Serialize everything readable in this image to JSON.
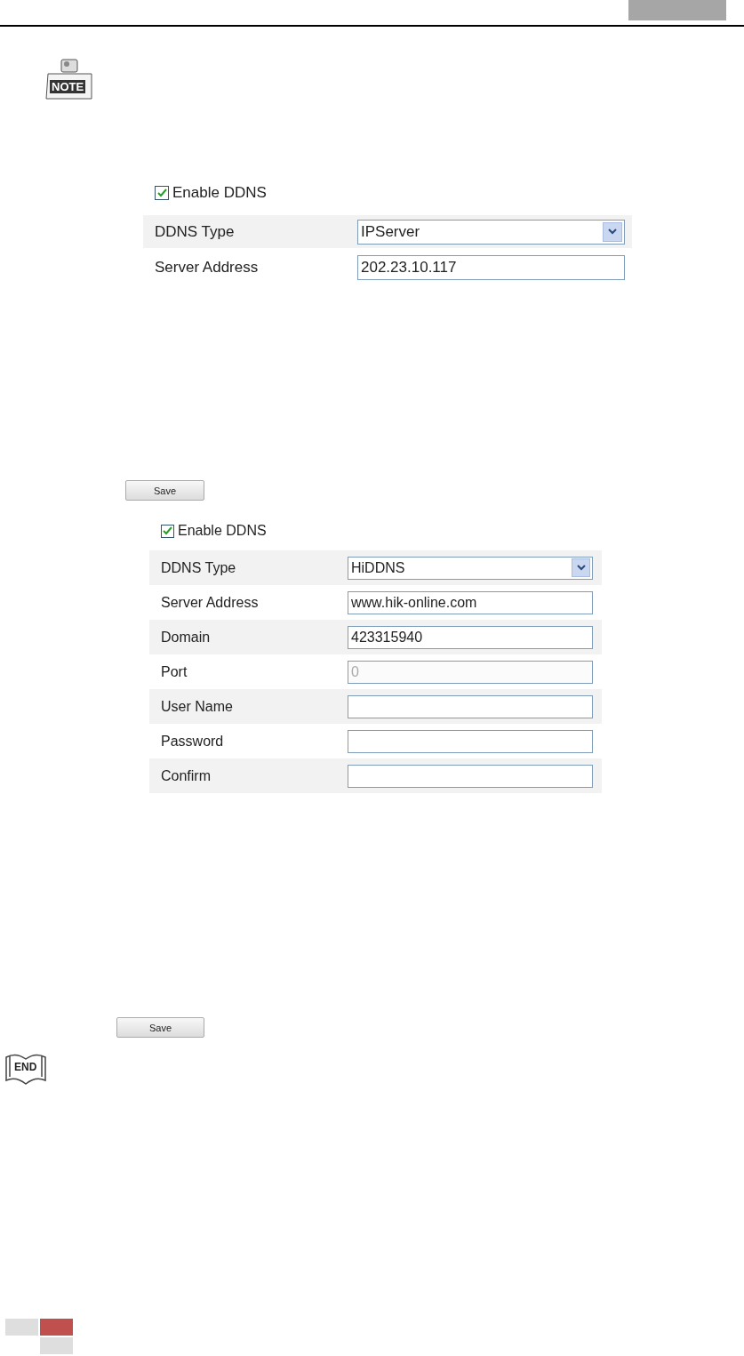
{
  "note": {
    "label": "NOTE"
  },
  "panels": [
    {
      "enable": {
        "label": "Enable DDNS",
        "checked": true
      },
      "rows": [
        {
          "label": "DDNS Type",
          "kind": "select",
          "value": "IPServer"
        },
        {
          "label": "Server Address",
          "kind": "input",
          "value": "202.23.10.117"
        }
      ],
      "save": "Save"
    },
    {
      "enable": {
        "label": "Enable DDNS",
        "checked": true
      },
      "rows": [
        {
          "label": "DDNS Type",
          "kind": "select",
          "value": "HiDDNS"
        },
        {
          "label": "Server Address",
          "kind": "input",
          "value": "www.hik-online.com"
        },
        {
          "label": "Domain",
          "kind": "input",
          "value": "423315940"
        },
        {
          "label": "Port",
          "kind": "input",
          "value": "0",
          "disabled": true
        },
        {
          "label": "User Name",
          "kind": "input"
        },
        {
          "label": "Password",
          "kind": "input"
        },
        {
          "label": "Confirm",
          "kind": "input"
        }
      ],
      "save": "Save"
    }
  ],
  "end": {
    "label": "END"
  }
}
